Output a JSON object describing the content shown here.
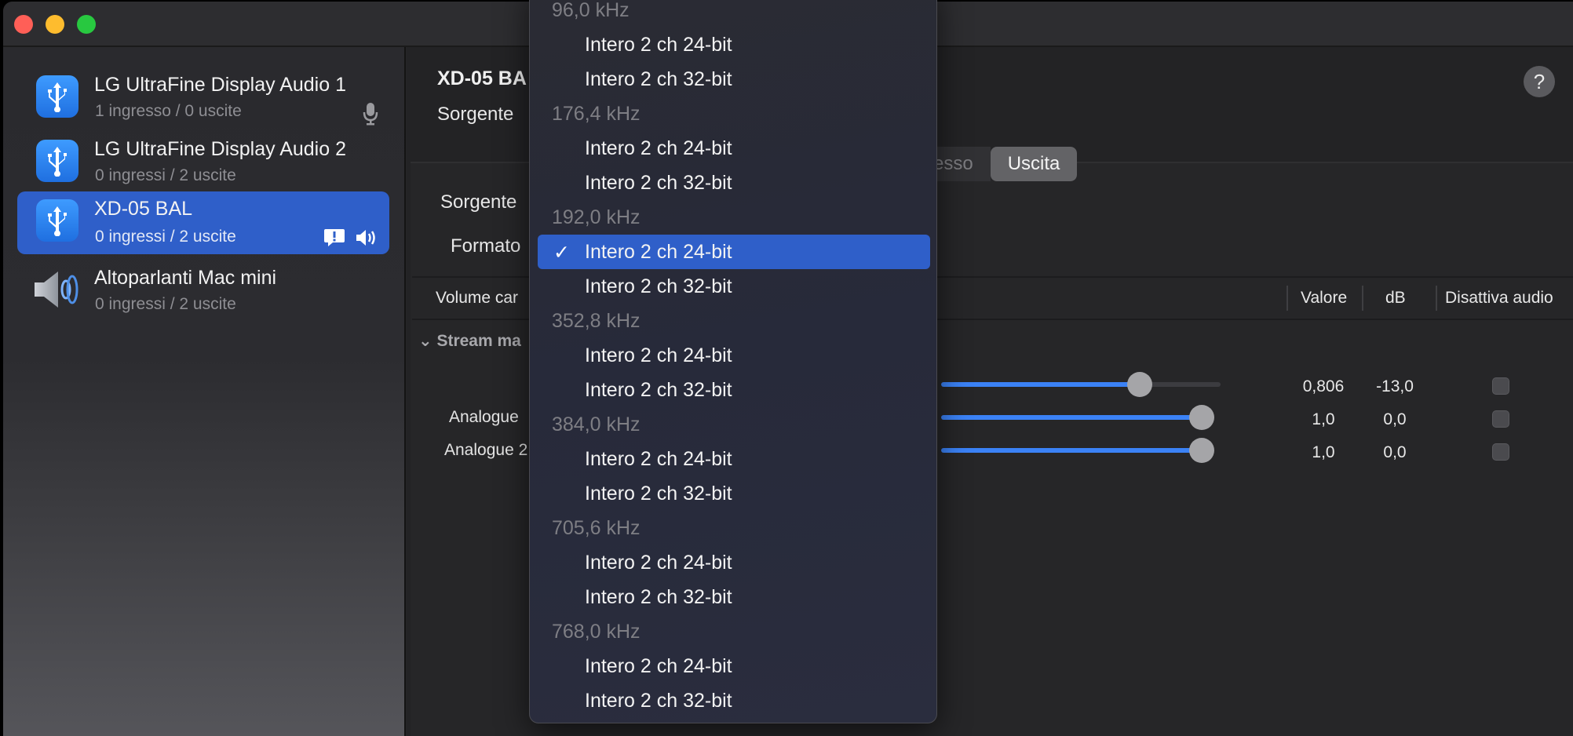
{
  "sidebar": {
    "devices": [
      {
        "name": "LG UltraFine Display Audio 1",
        "subtitle": "1 ingresso / 0 uscite",
        "icon": "usb-icon",
        "badges": [
          "microphone-icon"
        ],
        "selected": false
      },
      {
        "name": "LG UltraFine Display Audio 2",
        "subtitle": "0 ingressi / 2 uscite",
        "icon": "usb-icon",
        "badges": [],
        "selected": false
      },
      {
        "name": "XD-05 BAL",
        "subtitle": "0 ingressi / 2 uscite",
        "icon": "usb-icon",
        "badges": [
          "alert-bubble-icon",
          "speaker-volume-icon"
        ],
        "selected": true
      },
      {
        "name": "Altoparlanti Mac mini",
        "subtitle": "0 ingressi / 2 uscite",
        "icon": "speaker-icon",
        "badges": [],
        "selected": false
      }
    ]
  },
  "main": {
    "title": "XD-05 BA",
    "source_label": "Sorgente",
    "help": "?",
    "tabs": [
      {
        "label": "resso",
        "active": false
      },
      {
        "label": "Uscita",
        "active": true
      }
    ],
    "source_label_2": "Sorgente",
    "format_label": "Formato",
    "table_headers": {
      "volume": "Volume car",
      "value": "Valore",
      "db": "dB",
      "mute": "Disattiva audio"
    },
    "group_label": "Stream ma",
    "rows": [
      {
        "label": "",
        "value": "0,806",
        "db": "-13,0",
        "level": 0.806,
        "muted": false
      },
      {
        "label": "Analogue",
        "value": "1,0",
        "db": "0,0",
        "level": 1.0,
        "muted": false
      },
      {
        "label": "Analogue 2",
        "value": "1,0",
        "db": "0,0",
        "level": 1.0,
        "muted": false
      }
    ]
  },
  "menu": {
    "items": [
      {
        "type": "header",
        "label": "96,0 kHz"
      },
      {
        "type": "option",
        "label": "Intero 2 ch 24-bit"
      },
      {
        "type": "option",
        "label": "Intero 2 ch 32-bit"
      },
      {
        "type": "header",
        "label": "176,4 kHz"
      },
      {
        "type": "option",
        "label": "Intero 2 ch 24-bit"
      },
      {
        "type": "option",
        "label": "Intero 2 ch 32-bit"
      },
      {
        "type": "header",
        "label": "192,0 kHz"
      },
      {
        "type": "option",
        "label": "Intero 2 ch 24-bit",
        "selected": true,
        "check": "✓"
      },
      {
        "type": "option",
        "label": "Intero 2 ch 32-bit"
      },
      {
        "type": "header",
        "label": "352,8 kHz"
      },
      {
        "type": "option",
        "label": "Intero 2 ch 24-bit"
      },
      {
        "type": "option",
        "label": "Intero 2 ch 32-bit"
      },
      {
        "type": "header",
        "label": "384,0 kHz"
      },
      {
        "type": "option",
        "label": "Intero 2 ch 24-bit"
      },
      {
        "type": "option",
        "label": "Intero 2 ch 32-bit"
      },
      {
        "type": "header",
        "label": "705,6 kHz"
      },
      {
        "type": "option",
        "label": "Intero 2 ch 24-bit"
      },
      {
        "type": "option",
        "label": "Intero 2 ch 32-bit"
      },
      {
        "type": "header",
        "label": "768,0 kHz"
      },
      {
        "type": "option",
        "label": "Intero 2 ch 24-bit"
      },
      {
        "type": "option",
        "label": "Intero 2 ch 32-bit"
      }
    ]
  },
  "colors": {
    "accent": "#2f5fc9",
    "slider": "#3b82f6"
  }
}
